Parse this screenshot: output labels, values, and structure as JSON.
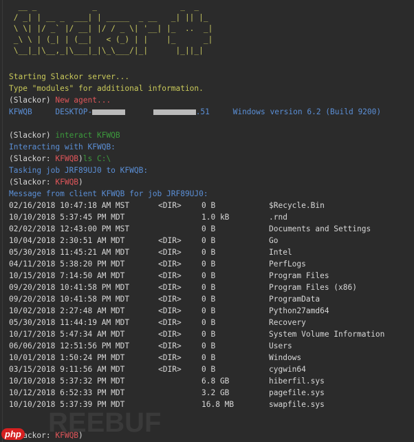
{
  "banner": "  __ _            _                  _  _\n / _| | __ _  ___| | _____  _ __   _| || |_\n \\ \\| |/ _` |/ __| |/ / _ \\| '__| |_  ..  _|\n _\\ \\ | (_| | (__|   < (_) | |    |_      _|\n \\__|_|\\__,_|\\___|_|\\_\\___/|_|      |_||_|",
  "lines": {
    "start": "Starting Slackor server...",
    "type_hint": "Type \"modules\" for additional information.",
    "prompt": "(Slackor) ",
    "new_agent": "New agent...",
    "agent_id": "KFWQB",
    "host": "DESKTOP-",
    "ip_suffix": ".51",
    "os": "Windows version 6.2 (Build 9200)",
    "cmd_interact": "interact KFWQB",
    "interacting": "Interacting with KFWQB:",
    "prompt_agent_open": "(Slackor: ",
    "prompt_agent_close": ")",
    "cmd_ls": "ls C:\\",
    "tasking": "Tasking job JRF89UJ0 to KFWQB:",
    "message": "Message from client KFWQB for job JRF89UJ0:"
  },
  "listing": [
    {
      "date": "02/16/2018 10:47:18 AM MST",
      "type": "<DIR>",
      "size": "0 B",
      "name": "$Recycle.Bin"
    },
    {
      "date": "10/10/2018 5:37:45 PM MDT",
      "type": "",
      "size": "1.0 kB",
      "name": ".rnd"
    },
    {
      "date": "02/02/2018 12:43:00 PM MST",
      "type": "",
      "size": "0 B",
      "name": "Documents and Settings"
    },
    {
      "date": "10/04/2018 2:30:51 AM MDT",
      "type": "<DIR>",
      "size": "0 B",
      "name": "Go"
    },
    {
      "date": "05/30/2018 11:45:21 AM MDT",
      "type": "<DIR>",
      "size": "0 B",
      "name": "Intel"
    },
    {
      "date": "04/11/2018 5:38:20 PM MDT",
      "type": "<DIR>",
      "size": "0 B",
      "name": "PerfLogs"
    },
    {
      "date": "10/15/2018 7:14:50 AM MDT",
      "type": "<DIR>",
      "size": "0 B",
      "name": "Program Files"
    },
    {
      "date": "09/20/2018 10:41:58 PM MDT",
      "type": "<DIR>",
      "size": "0 B",
      "name": "Program Files (x86)"
    },
    {
      "date": "09/20/2018 10:41:58 PM MDT",
      "type": "<DIR>",
      "size": "0 B",
      "name": "ProgramData"
    },
    {
      "date": "10/02/2018 2:27:48 AM MDT",
      "type": "<DIR>",
      "size": "0 B",
      "name": "Python27amd64"
    },
    {
      "date": "05/30/2018 11:44:19 AM MDT",
      "type": "<DIR>",
      "size": "0 B",
      "name": "Recovery"
    },
    {
      "date": "10/17/2018 5:47:34 AM MDT",
      "type": "<DIR>",
      "size": "0 B",
      "name": "System Volume Information"
    },
    {
      "date": "06/06/2018 12:51:56 PM MDT",
      "type": "<DIR>",
      "size": "0 B",
      "name": "Users"
    },
    {
      "date": "10/01/2018 1:50:24 PM MDT",
      "type": "<DIR>",
      "size": "0 B",
      "name": "Windows"
    },
    {
      "date": "03/15/2018 9:11:56 AM MDT",
      "type": "<DIR>",
      "size": "0 B",
      "name": "cygwin64"
    },
    {
      "date": "10/10/2018 5:37:32 PM MDT",
      "type": "",
      "size": "6.8 GB",
      "name": "hiberfil.sys"
    },
    {
      "date": "10/12/2018 6:52:33 PM MDT",
      "type": "",
      "size": "3.2 GB",
      "name": "pagefile.sys"
    },
    {
      "date": "10/10/2018 5:37:39 PM MDT",
      "type": "",
      "size": "16.8 MB",
      "name": "swapfile.sys"
    }
  ],
  "watermark": "REEBUF",
  "php_badge": "php"
}
